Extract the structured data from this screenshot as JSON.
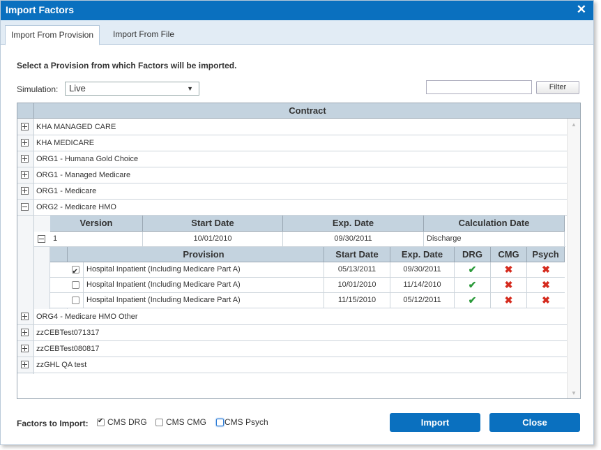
{
  "dialog": {
    "title": "Import Factors",
    "close_icon": "✕"
  },
  "tabs": [
    {
      "label": "Import From Provision"
    },
    {
      "label": "Import From File"
    }
  ],
  "instruction": "Select a Provision from which Factors will be imported.",
  "simulation": {
    "label": "Simulation:",
    "selected": "Live"
  },
  "filter": {
    "value": "",
    "button_label": "Filter"
  },
  "grid": {
    "header": "Contract",
    "contracts": [
      {
        "name": "KHA MANAGED CARE",
        "expanded": false
      },
      {
        "name": "KHA MEDICARE",
        "expanded": false
      },
      {
        "name": "ORG1 - Humana Gold Choice",
        "expanded": false
      },
      {
        "name": "ORG1 - Managed Medicare",
        "expanded": false
      },
      {
        "name": "ORG1 - Medicare",
        "expanded": false
      },
      {
        "name": "ORG2 - Medicare HMO",
        "expanded": true
      },
      {
        "name": "ORG4 - Medicare HMO Other",
        "expanded": false
      },
      {
        "name": "zzCEBTest071317",
        "expanded": false
      },
      {
        "name": "zzCEBTest080817",
        "expanded": false
      },
      {
        "name": "zzGHL QA test",
        "expanded": false
      }
    ]
  },
  "versions": {
    "headers": [
      "Version",
      "Start Date",
      "Exp. Date",
      "Calculation Date"
    ],
    "rows": [
      {
        "version": "1",
        "start_date": "10/01/2010",
        "exp_date": "09/30/2011",
        "calculation_date": "Discharge"
      }
    ]
  },
  "provisions": {
    "headers": [
      "Provision",
      "Start Date",
      "Exp. Date",
      "DRG",
      "CMG",
      "Psych"
    ],
    "rows": [
      {
        "checked": true,
        "name": "Hospital Inpatient (Including Medicare Part A)",
        "start_date": "05/13/2011",
        "exp_date": "09/30/2011",
        "drg": "check-icon",
        "cmg": "x-icon",
        "psych": "x-icon"
      },
      {
        "checked": false,
        "name": "Hospital Inpatient (Including Medicare Part A)",
        "start_date": "10/01/2010",
        "exp_date": "11/14/2010",
        "drg": "check-icon",
        "cmg": "x-icon",
        "psych": "x-icon"
      },
      {
        "checked": false,
        "name": "Hospital Inpatient (Including Medicare Part A)",
        "start_date": "11/15/2010",
        "exp_date": "05/12/2011",
        "drg": "check-icon",
        "cmg": "x-icon",
        "psych": "x-icon"
      }
    ]
  },
  "footer": {
    "label": "Factors to Import:",
    "options": [
      {
        "label": "CMS DRG",
        "checked": true
      },
      {
        "label": "CMS CMG",
        "checked": false
      },
      {
        "label": "CMS Psych",
        "checked": false
      }
    ],
    "import_label": "Import",
    "close_label": "Close"
  },
  "colors": {
    "accent": "#0a70bf",
    "header_bg": "#c4d3df",
    "check": "#2b9a3a",
    "cross": "#d52b1e"
  }
}
